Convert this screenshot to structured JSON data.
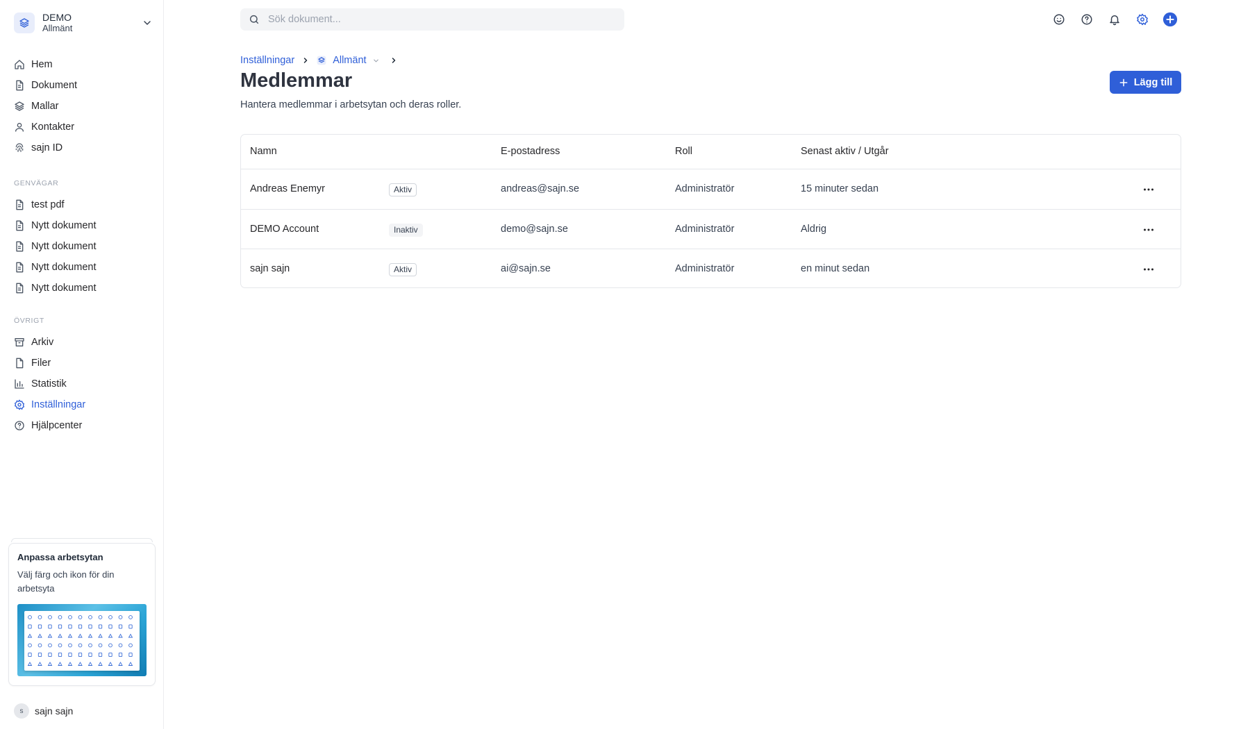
{
  "workspace": {
    "name": "DEMO",
    "subtitle": "Allmänt"
  },
  "nav_main": [
    {
      "label": "Hem",
      "icon": "home-icon"
    },
    {
      "label": "Dokument",
      "icon": "document-icon"
    },
    {
      "label": "Mallar",
      "icon": "layers-icon"
    },
    {
      "label": "Kontakter",
      "icon": "user-icon"
    },
    {
      "label": "sajn ID",
      "icon": "fingerprint-icon"
    }
  ],
  "shortcuts": {
    "heading": "GENVÄGAR",
    "items": [
      {
        "label": "test pdf",
        "icon": "document-icon"
      },
      {
        "label": "Nytt dokument",
        "icon": "document-icon"
      },
      {
        "label": "Nytt dokument",
        "icon": "document-icon"
      },
      {
        "label": "Nytt dokument",
        "icon": "document-icon"
      },
      {
        "label": "Nytt dokument",
        "icon": "document-icon"
      }
    ]
  },
  "other": {
    "heading": "ÖVRIGT",
    "items": [
      {
        "label": "Arkiv",
        "icon": "archive-icon"
      },
      {
        "label": "Filer",
        "icon": "file-icon"
      },
      {
        "label": "Statistik",
        "icon": "bar-chart-icon"
      },
      {
        "label": "Inställningar",
        "icon": "gear-icon",
        "active": true
      },
      {
        "label": "Hjälpcenter",
        "icon": "help-circle-icon"
      }
    ]
  },
  "promo": {
    "title": "Anpassa arbetsytan",
    "text": "Välj färg och ikon för din arbetsyta"
  },
  "user": {
    "initial": "s",
    "name": "sajn sajn"
  },
  "search": {
    "placeholder": "Sök dokument..."
  },
  "breadcrumb": {
    "parent": "Inställningar",
    "workspace": "Allmänt"
  },
  "page": {
    "title": "Medlemmar",
    "subtitle": "Hantera medlemmar i arbetsytan och deras roller.",
    "add_label": "Lägg till"
  },
  "table": {
    "columns": [
      "Namn",
      "E-postadress",
      "Roll",
      "Senast aktiv / Utgår"
    ],
    "rows": [
      {
        "name": "Andreas Enemyr",
        "status": "Aktiv",
        "email": "andreas@sajn.se",
        "role": "Administratör",
        "last": "15 minuter sedan"
      },
      {
        "name": "DEMO Account",
        "status": "Inaktiv",
        "email": "demo@sajn.se",
        "role": "Administratör",
        "last": "Aldrig"
      },
      {
        "name": "sajn sajn",
        "status": "Aktiv",
        "email": "ai@sajn.se",
        "role": "Administratör",
        "last": "en minut sedan"
      }
    ]
  },
  "colors": {
    "accent": "#2f5fd8",
    "border": "#e5e7eb"
  }
}
